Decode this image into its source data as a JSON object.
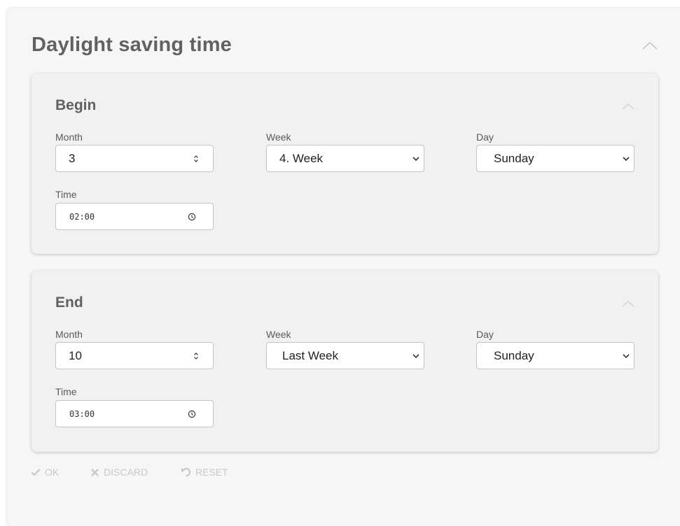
{
  "panel": {
    "title": "Daylight saving time"
  },
  "begin": {
    "title": "Begin",
    "month_label": "Month",
    "month_value": "3",
    "week_label": "Week",
    "week_value": "4. Week",
    "day_label": "Day",
    "day_value": "Sunday",
    "time_label": "Time",
    "time_value": "02:00"
  },
  "end": {
    "title": "End",
    "month_label": "Month",
    "month_value": "10",
    "week_label": "Week",
    "week_value": "Last Week",
    "day_label": "Day",
    "day_value": "Sunday",
    "time_label": "Time",
    "time_value": "03:00"
  },
  "actions": {
    "ok_label": "OK",
    "discard_label": "DISCARD",
    "reset_label": "RESET"
  },
  "colors": {
    "title_text": "#616161",
    "card_bg": "#f1f1f1",
    "panel_bg": "#f6f6f6",
    "disabled_action": "#c8c8c8"
  },
  "icons": {
    "collapse": "chevron-up-icon",
    "spinner": "spinner-arrows-icon",
    "dropdown": "chevron-down-icon",
    "time": "clock-icon",
    "ok": "check-icon",
    "discard": "x-icon",
    "reset": "undo-icon"
  }
}
